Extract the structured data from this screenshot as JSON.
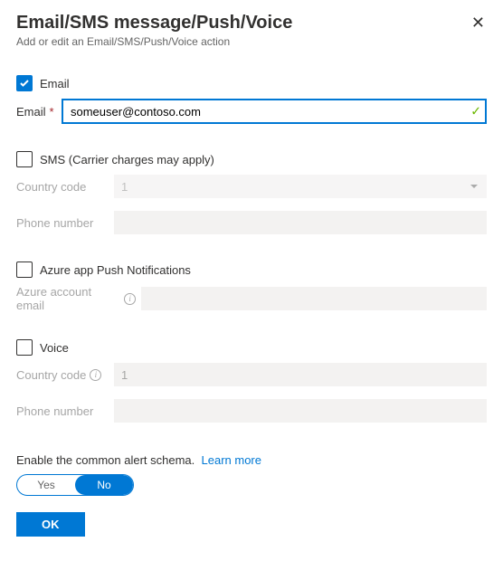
{
  "header": {
    "title": "Email/SMS message/Push/Voice",
    "subtitle": "Add or edit an Email/SMS/Push/Voice action"
  },
  "email": {
    "checkbox_label": "Email",
    "checked": true,
    "field_label": "Email",
    "value": "someuser@contoso.com"
  },
  "sms": {
    "checkbox_label": "SMS (Carrier charges may apply)",
    "checked": false,
    "country_code_label": "Country code",
    "country_code_value": "1",
    "phone_label": "Phone number",
    "phone_value": ""
  },
  "push": {
    "checkbox_label": "Azure app Push Notifications",
    "checked": false,
    "account_label": "Azure account email",
    "account_value": ""
  },
  "voice": {
    "checkbox_label": "Voice",
    "checked": false,
    "country_code_label": "Country code",
    "country_code_value": "1",
    "phone_label": "Phone number",
    "phone_value": ""
  },
  "schema": {
    "text": "Enable the common alert schema.",
    "link": "Learn more",
    "yes": "Yes",
    "no": "No",
    "value": "No"
  },
  "buttons": {
    "ok": "OK"
  }
}
